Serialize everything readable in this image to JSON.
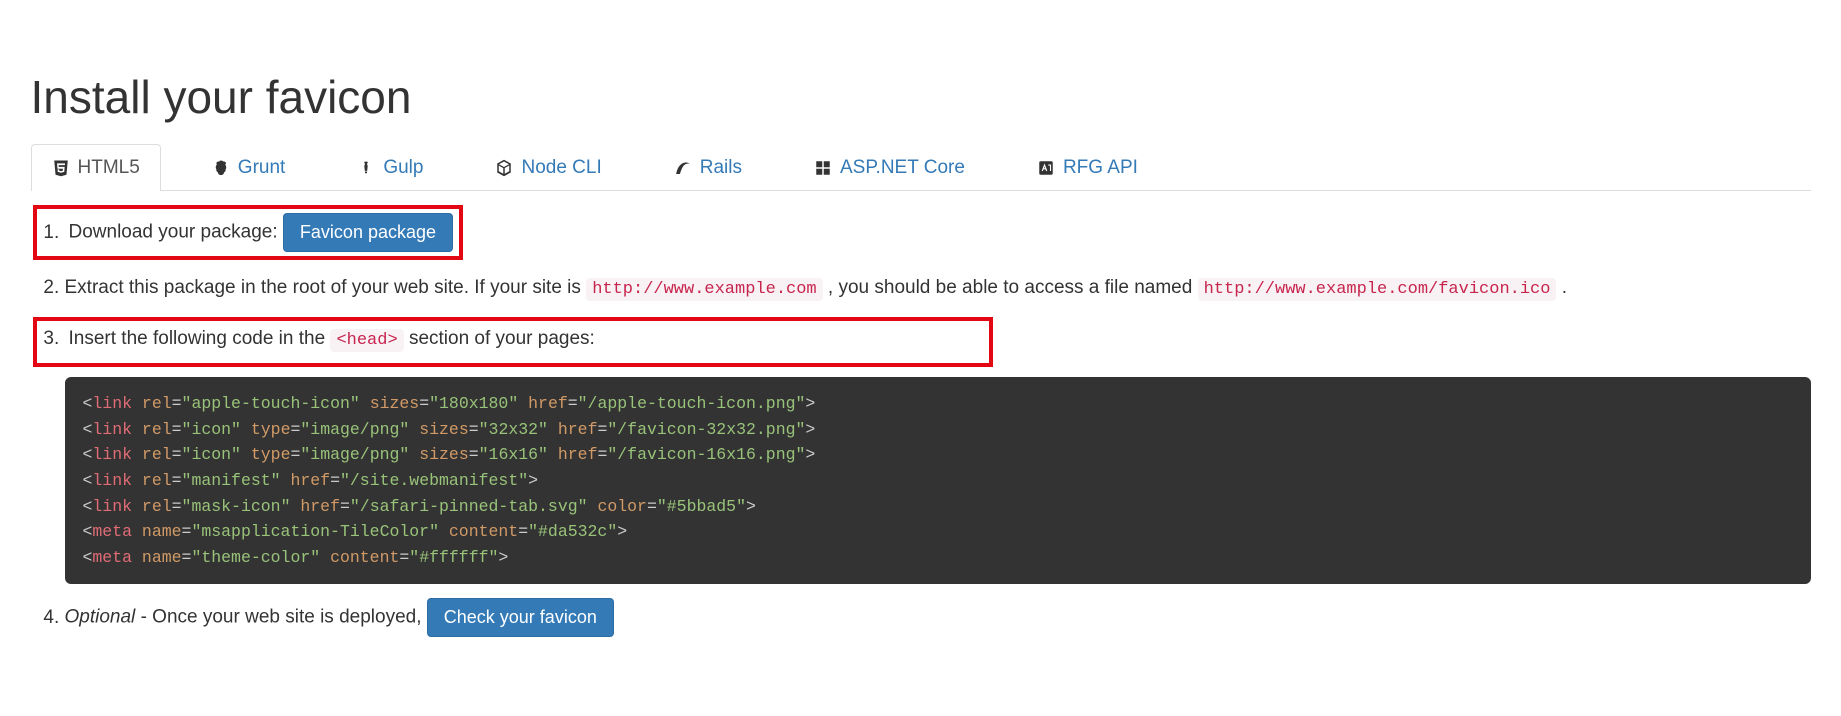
{
  "title": "Install your favicon",
  "tabs": [
    {
      "label": "HTML5"
    },
    {
      "label": "Grunt"
    },
    {
      "label": "Gulp"
    },
    {
      "label": "Node CLI"
    },
    {
      "label": "Rails"
    },
    {
      "label": "ASP.NET Core"
    },
    {
      "label": "RFG API"
    }
  ],
  "step1": {
    "text": "Download your package:",
    "button": "Favicon package"
  },
  "step2": {
    "pre": "Extract this package in the root of your web site. If your site is ",
    "url1": "http://www.example.com",
    "mid": ", you should be able to access a file named ",
    "url2": "http://www.example.com/favicon.ico",
    "post": "."
  },
  "step3": {
    "pre": "Insert the following code in the ",
    "head": "<head>",
    "post": " section of your pages:",
    "code": [
      {
        "tag": "link",
        "attrs": [
          [
            "rel",
            "apple-touch-icon"
          ],
          [
            "sizes",
            "180x180"
          ],
          [
            "href",
            "/apple-touch-icon.png"
          ]
        ]
      },
      {
        "tag": "link",
        "attrs": [
          [
            "rel",
            "icon"
          ],
          [
            "type",
            "image/png"
          ],
          [
            "sizes",
            "32x32"
          ],
          [
            "href",
            "/favicon-32x32.png"
          ]
        ]
      },
      {
        "tag": "link",
        "attrs": [
          [
            "rel",
            "icon"
          ],
          [
            "type",
            "image/png"
          ],
          [
            "sizes",
            "16x16"
          ],
          [
            "href",
            "/favicon-16x16.png"
          ]
        ]
      },
      {
        "tag": "link",
        "attrs": [
          [
            "rel",
            "manifest"
          ],
          [
            "href",
            "/site.webmanifest"
          ]
        ]
      },
      {
        "tag": "link",
        "attrs": [
          [
            "rel",
            "mask-icon"
          ],
          [
            "href",
            "/safari-pinned-tab.svg"
          ],
          [
            "color",
            "#5bbad5"
          ]
        ]
      },
      {
        "tag": "meta",
        "attrs": [
          [
            "name",
            "msapplication-TileColor"
          ],
          [
            "content",
            "#da532c"
          ]
        ]
      },
      {
        "tag": "meta",
        "attrs": [
          [
            "name",
            "theme-color"
          ],
          [
            "content",
            "#ffffff"
          ]
        ]
      }
    ]
  },
  "step4": {
    "optional": "Optional",
    "text": " - Once your web site is deployed, ",
    "button": "Check your favicon"
  }
}
